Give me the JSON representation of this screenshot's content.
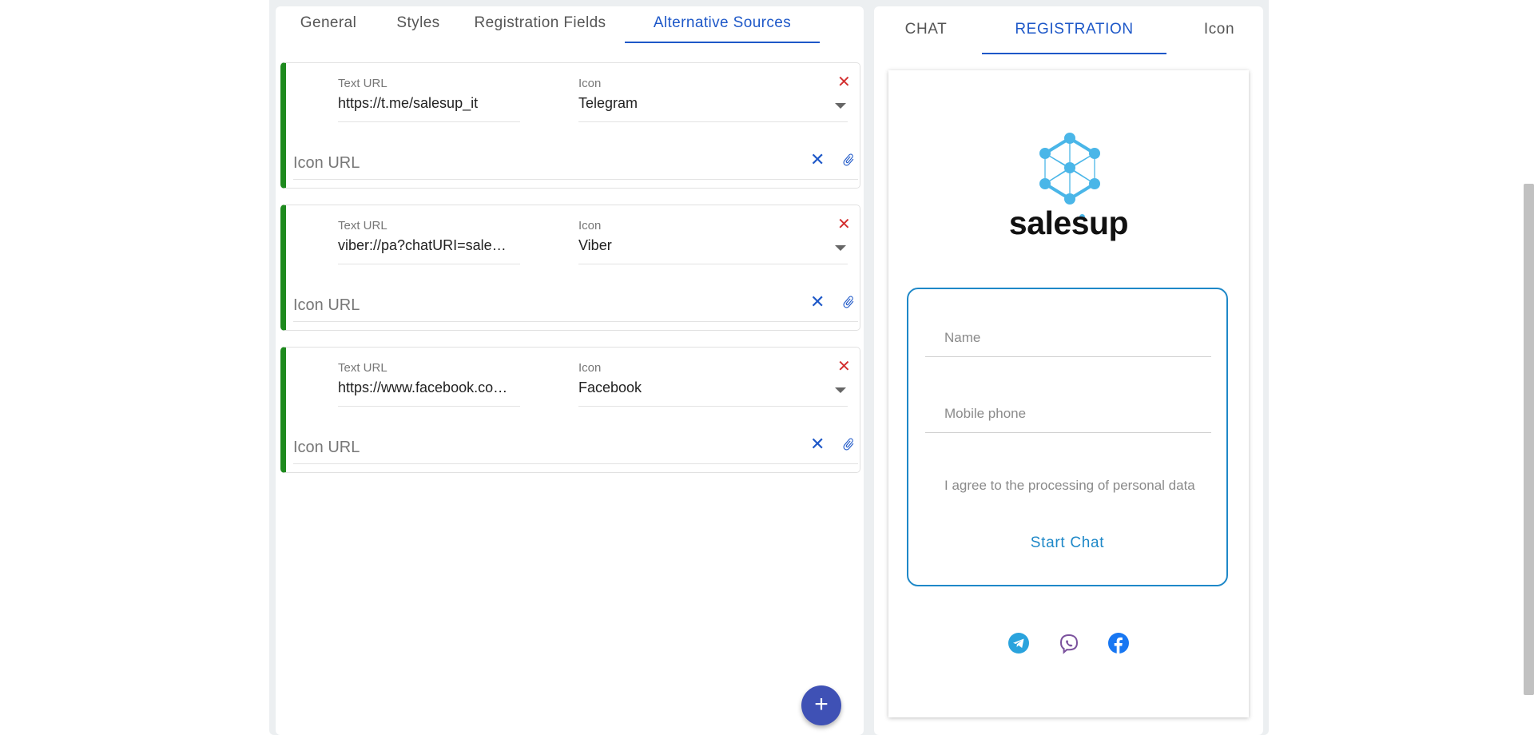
{
  "tabs": [
    "General",
    "Styles",
    "Registration Fields",
    "Alternative Sources"
  ],
  "active_tab": "Alternative Sources",
  "sources": [
    {
      "text_url_label": "Text URL",
      "text_url": "https://t.me/salesup_it",
      "icon_label": "Icon",
      "icon": "Telegram",
      "icon_url_placeholder": "Icon URL"
    },
    {
      "text_url_label": "Text URL",
      "text_url": "viber://pa?chatURI=sale…",
      "icon_label": "Icon",
      "icon": "Viber",
      "icon_url_placeholder": "Icon URL"
    },
    {
      "text_url_label": "Text URL",
      "text_url": "https://www.facebook.co…",
      "icon_label": "Icon",
      "icon": "Facebook",
      "icon_url_placeholder": "Icon URL"
    }
  ],
  "add_button_label": "+",
  "preview_tabs": [
    "CHAT",
    "REGISTRATION",
    "Icon"
  ],
  "active_preview_tab": "REGISTRATION",
  "preview": {
    "brand": "salesup",
    "name_placeholder": "Name",
    "phone_placeholder": "Mobile phone",
    "agree_text": "I agree to the processing of personal data",
    "start_button": "Start Chat",
    "social_icons": [
      "telegram-icon",
      "viber-icon",
      "facebook-icon"
    ]
  },
  "colors": {
    "accent": "#1e58c8",
    "card_stripe": "#1e8a1e",
    "delete": "#d32f2f",
    "fab": "#3f51b5",
    "preview_accent": "#1e88c8",
    "logo": "#4ab6e8"
  }
}
